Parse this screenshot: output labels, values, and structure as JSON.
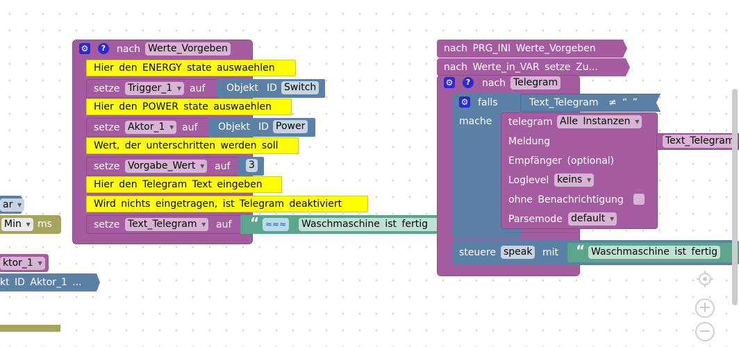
{
  "left_partial": {
    "var_field": "ar",
    "min_field": "Min",
    "ms_label": "ms",
    "aktor_field": "ktor_1",
    "objekt_id_text": "kt  ID  Aktor_1  ..."
  },
  "werte_block": {
    "nach_label": "nach",
    "func_name": "Werte_Vorgeben",
    "comments": [
      "Hier  den  ENERGY  state  auswaehlen",
      "Hier  den  POWER  state  auswaehlen",
      "Wert,  der  unterschritten  werden  soll",
      "Hier  den  Telegram  Text  eingeben",
      "Wird  nichts  eingetragen,  ist  Telegram  deaktiviert"
    ],
    "setze_label": "setze",
    "auf_label": "auf",
    "set1_var": "Trigger_1",
    "objekt_label": "Objekt",
    "id_label": "ID",
    "set1_id": "Switch",
    "set2_var": "Aktor_1",
    "set2_id": "Power",
    "set3_var": "Vorgabe_Wert",
    "set3_value": "3",
    "set4_var": "Text_Telegram",
    "text_quote": "“",
    "set4_text": "Waschmaschine  ist  fertig"
  },
  "right_column": {
    "call1_label": "nach  PRG_INI    Werte_Vorgeben",
    "call2_label": "nach  Werte_in_VAR    setze  Zu...",
    "nach_label": "nach",
    "func_name": "Telegram",
    "falls_label": "falls",
    "condition_var": "Text_Telegram",
    "neq_symbol": "≠",
    "empty_text": "“    ”",
    "mache_label": "mache",
    "telegram_label": "telegram",
    "instances": "Alle  Instanzen",
    "meldung_label": "Meldung",
    "meldung_value": "Text_Telegram",
    "empfaenger_label": "Empfänger  (optional)",
    "loglevel_label": "Loglevel",
    "loglevel_value": "keins",
    "ohne_label": "ohne  Benachrichtigung",
    "parsemode_label": "Parsemode",
    "parsemode_value": "default",
    "steuere_label": "steuere",
    "speak_value": "speak",
    "mit_label": "mit",
    "quote": "“",
    "speak_text": "Waschmaschine  ist  fertig"
  },
  "controls": {
    "center_icon": "target-icon",
    "zoom_in_icon": "plus",
    "zoom_out_icon": "minus",
    "zoom_in_symbol": "+",
    "zoom_out_symbol": "−"
  }
}
